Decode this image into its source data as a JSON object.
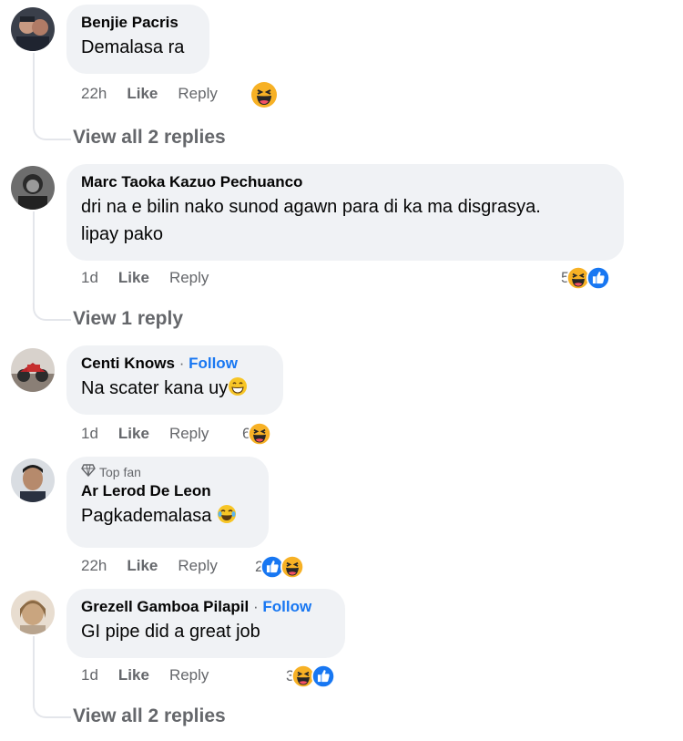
{
  "colors": {
    "bubble": "#f0f2f5",
    "meta_text": "#65676b",
    "follow": "#1877f2",
    "haha": "#f7b125",
    "like": "#1877f2"
  },
  "comments": [
    {
      "author": "Benjie Pacris",
      "text": "Demalasa ra",
      "time": "22h",
      "like_label": "Like",
      "reply_label": "Reply",
      "reactions": {
        "count": "",
        "icons": [
          "haha-icon"
        ]
      },
      "view_replies": "View all 2 replies"
    },
    {
      "author": "Marc Taoka Kazuo Pechuanco",
      "text_line1": "dri na e bilin nako sunod agawn para di ka ma disgrasya.",
      "text_line2": "lipay pako",
      "time": "1d",
      "like_label": "Like",
      "reply_label": "Reply",
      "reactions": {
        "count": "5",
        "icons": [
          "haha-icon",
          "like-icon"
        ]
      },
      "view_replies": "View 1 reply"
    },
    {
      "author": "Centi Knows",
      "follow": "Follow",
      "separator": "·",
      "text": "Na scater kana uy",
      "time": "1d",
      "like_label": "Like",
      "reply_label": "Reply",
      "reactions": {
        "count": "6",
        "icons": [
          "haha-icon"
        ]
      }
    },
    {
      "badge": "Top fan",
      "author": "Ar Lerod De Leon",
      "text": "Pagkademalasa",
      "time": "22h",
      "like_label": "Like",
      "reply_label": "Reply",
      "reactions": {
        "count": "2",
        "icons": [
          "like-icon",
          "haha-icon"
        ]
      }
    },
    {
      "author": "Grezell Gamboa Pilapil",
      "follow": "Follow",
      "separator": "·",
      "text": "GI pipe did a great job",
      "time": "1d",
      "like_label": "Like",
      "reply_label": "Reply",
      "reactions": {
        "count": "3",
        "icons": [
          "haha-icon",
          "like-icon"
        ]
      },
      "view_replies": "View all 2 replies"
    }
  ]
}
